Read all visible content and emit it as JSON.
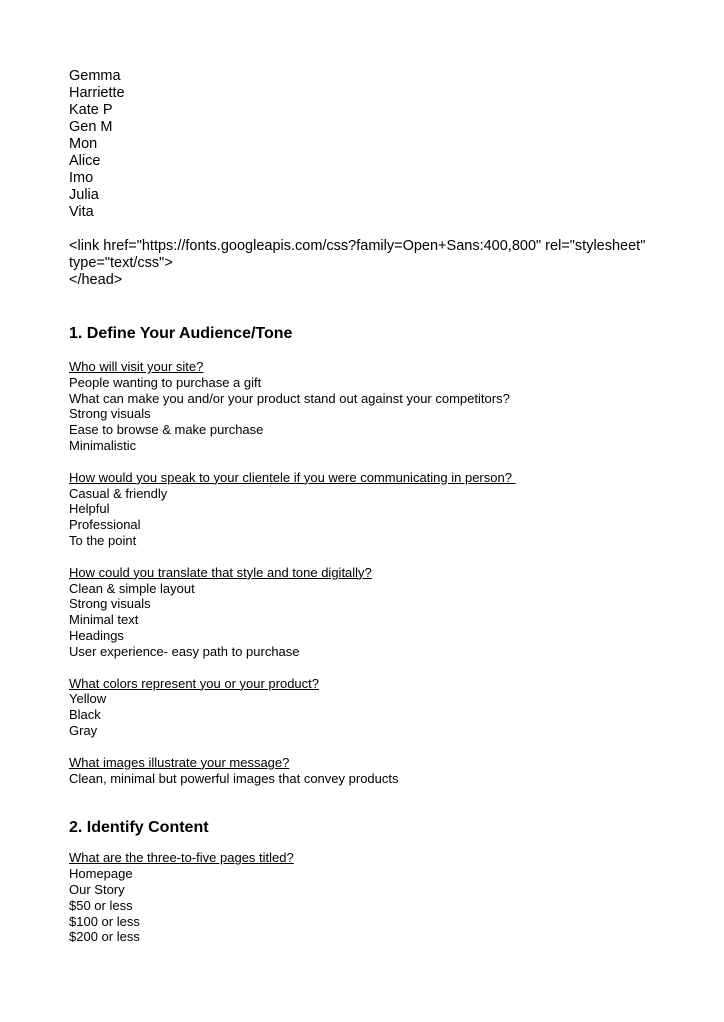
{
  "names": [
    "Gemma",
    "Harriette",
    "Kate P",
    "Gen M",
    "Mon",
    "Alice",
    "Imo",
    "Julia",
    "Vita"
  ],
  "code_lines": [
    "<link href=\"https://fonts.googleapis.com/css?family=Open+Sans:400,800\" rel=\"stylesheet\"",
    "type=\"text/css\">",
    "</head>"
  ],
  "section1": {
    "heading": "1. Define Your Audience/Tone",
    "questions": [
      {
        "question": "Who will visit your site?",
        "answers": [
          "People wanting to purchase a gift",
          "What can make you and/or your product stand out against your competitors?",
          "Strong visuals",
          "Ease to browse & make purchase",
          "Minimalistic"
        ]
      },
      {
        "question": "How would you speak to your clientele if you were communicating in person? ",
        "answers": [
          "Casual & friendly",
          "Helpful",
          "Professional",
          "To the point"
        ]
      },
      {
        "question": "How could you translate that style and tone digitally?",
        "answers": [
          "Clean & simple layout",
          "Strong visuals",
          "Minimal text",
          "Headings",
          "User experience- easy path to purchase"
        ]
      },
      {
        "question": "What colors represent you or your product?",
        "answers": [
          "Yellow",
          "Black",
          "Gray"
        ]
      },
      {
        "question": "What images illustrate your message?",
        "answers": [
          "Clean, minimal but powerful images that convey products"
        ]
      }
    ]
  },
  "section2": {
    "heading": "2. Identify Content",
    "questions": [
      {
        "question": "What are the three-to-five pages titled?",
        "answers": [
          "Homepage",
          "Our Story",
          "$50 or less",
          "$100 or less",
          "$200 or less"
        ]
      }
    ]
  }
}
